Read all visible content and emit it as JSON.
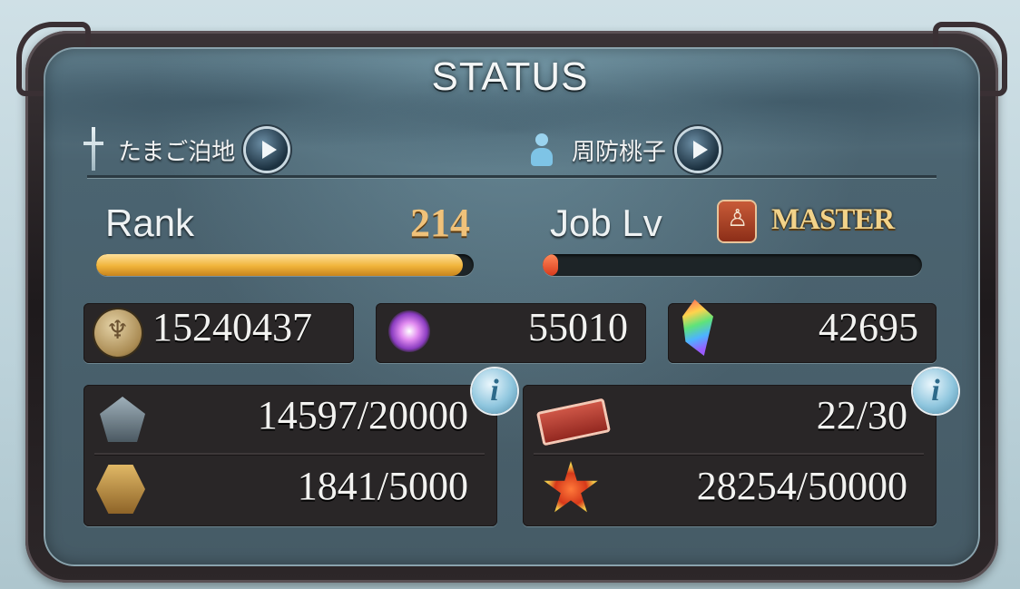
{
  "header": {
    "title": "STATUS"
  },
  "user": {
    "name": "たまご泊地",
    "character": "周防桃子"
  },
  "rank": {
    "label": "Rank",
    "value": "214",
    "progress": 0.97
  },
  "job": {
    "label": "Job Lv",
    "level": "MASTER",
    "progress": 0.02
  },
  "currencies": {
    "rupie": "15240437",
    "crystal": "55010",
    "prism": "42695"
  },
  "stamina": {
    "ap": "14597/20000",
    "bp": "1841/5000",
    "tickets": "22/30",
    "renown": "28254/50000"
  },
  "colors": {
    "rank_bar": "#f0b43a",
    "job_bar": "#d93a1c",
    "panel": "#4b6471"
  },
  "icons": {
    "user": "sword-icon",
    "character": "person-icon",
    "play": "play-icon",
    "info": "info-icon"
  }
}
